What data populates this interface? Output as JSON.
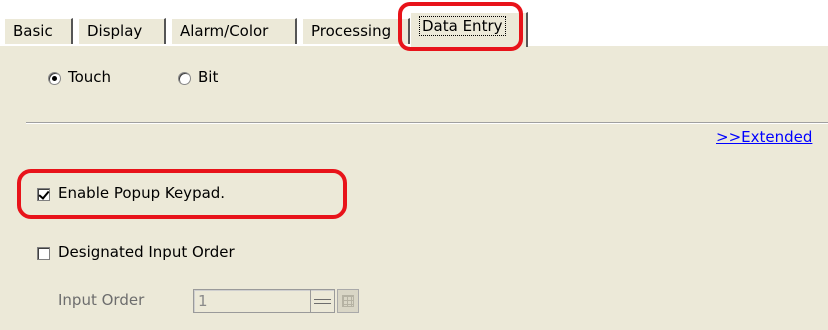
{
  "tabs": [
    {
      "label": "Basic",
      "active": false
    },
    {
      "label": "Display",
      "active": false
    },
    {
      "label": "Alarm/Color",
      "active": false
    },
    {
      "label": "Processing",
      "active": false
    },
    {
      "label": "Data Entry",
      "active": true
    }
  ],
  "mode": {
    "options": [
      {
        "label": "Touch",
        "selected": true
      },
      {
        "label": "Bit",
        "selected": false
      }
    ]
  },
  "extended_link": ">>Extended",
  "enable_popup_keypad": {
    "label": "Enable Popup Keypad.",
    "checked": true
  },
  "designated_input_order": {
    "label": "Designated Input Order",
    "checked": false
  },
  "input_order": {
    "label": "Input Order",
    "value": "1",
    "enabled": false
  },
  "colors": {
    "highlight": "#e8131a",
    "link": "#0000ff",
    "panel": "#ece9d8"
  }
}
